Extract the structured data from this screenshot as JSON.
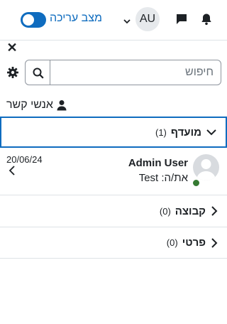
{
  "navbar": {
    "user_initials": "AU",
    "edit_mode_label": "מצב עריכה",
    "edit_mode_on": true
  },
  "drawer": {
    "search_placeholder": "חיפוש",
    "contacts_label": "אנשי קשר",
    "sections": {
      "starred": {
        "title": "מועדף",
        "count": "(1)",
        "expanded": true
      },
      "group": {
        "title": "קבוצה",
        "count": "(0)",
        "expanded": false
      },
      "private": {
        "title": "פרטי",
        "count": "(0)",
        "expanded": false
      }
    },
    "conversation": {
      "name": "Admin User",
      "preview": "את/ה: Test",
      "date": "20/06/24",
      "online": true
    }
  },
  "colors": {
    "accent": "#0f6cbf",
    "online": "#357a32",
    "border": "#dee2e6"
  }
}
